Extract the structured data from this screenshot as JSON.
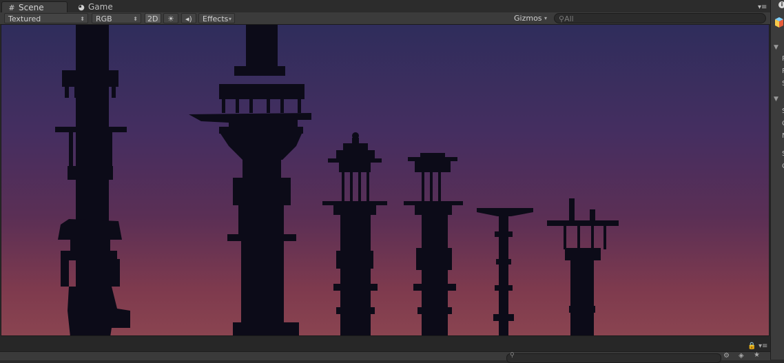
{
  "tabs": [
    {
      "label": "Scene",
      "icon": "grid-icon"
    },
    {
      "label": "Game",
      "icon": "pacman-icon"
    }
  ],
  "toolbar": {
    "draw_mode": "Textured",
    "render_mode": "RGB",
    "mode_2d": "2D",
    "effects": "Effects",
    "gizmos": "Gizmos",
    "search_placeholder": "All"
  },
  "scene": {
    "sky_colors": [
      "#2f2d5c",
      "#5b2f55",
      "#8a4450"
    ],
    "silhouette_color": "#0c0b18"
  },
  "inspector": {
    "fragments": [
      "R",
      "R",
      "S",
      "S",
      "C",
      "N",
      "S",
      "C"
    ]
  }
}
